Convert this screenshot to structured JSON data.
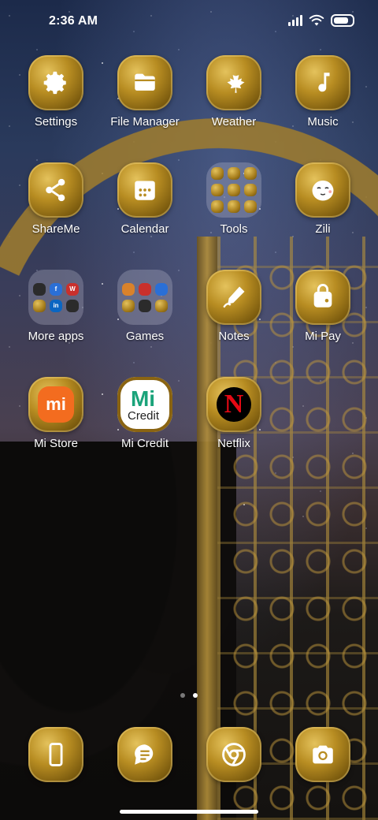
{
  "status_bar": {
    "time": "2:36 AM",
    "signal_bars": 4,
    "icons": [
      "signal-icon",
      "wifi-icon",
      "battery-icon"
    ]
  },
  "apps": {
    "row1": [
      {
        "label": "Settings",
        "icon": "gear-icon"
      },
      {
        "label": "File Manager",
        "icon": "folder-icon"
      },
      {
        "label": "Weather",
        "icon": "maple-leaf-icon"
      },
      {
        "label": "Music",
        "icon": "music-note-icon"
      }
    ],
    "row2": [
      {
        "label": "ShareMe",
        "icon": "share-icon"
      },
      {
        "label": "Calendar",
        "icon": "calendar-icon"
      },
      {
        "label": "Tools",
        "icon": "folder-grid-icon"
      },
      {
        "label": "Zili",
        "icon": "smiley-face-icon"
      }
    ],
    "row3": [
      {
        "label": "More apps",
        "icon": "folder-grid-icon"
      },
      {
        "label": "Games",
        "icon": "folder-grid-icon"
      },
      {
        "label": "Notes",
        "icon": "pen-icon"
      },
      {
        "label": "Mi Pay",
        "icon": "shopping-bag-icon"
      }
    ],
    "row4": [
      {
        "label": "Mi Store",
        "icon": "mi-logo-icon",
        "mark": "mi"
      },
      {
        "label": "Mi Credit",
        "icon": "mi-credit-logo-icon",
        "mark": "Mi",
        "submark": "Credit"
      },
      {
        "label": "Netflix",
        "icon": "netflix-logo-icon",
        "mark": "N"
      }
    ]
  },
  "folders": {
    "more_apps_badges": [
      "",
      "f",
      "W",
      "",
      "in",
      ""
    ],
    "games_badges": [
      "",
      "",
      "",
      "",
      "",
      ""
    ]
  },
  "dock": [
    {
      "icon": "phone-icon"
    },
    {
      "icon": "messages-icon"
    },
    {
      "icon": "chrome-icon"
    },
    {
      "icon": "camera-icon"
    }
  ],
  "page_indicator": {
    "pages": 2,
    "active": 2
  },
  "colors": {
    "icon_gold": "#b88d22",
    "mi_orange": "#f36c1f",
    "netflix_red": "#e50914",
    "mi_credit_green": "#1aa37a"
  }
}
